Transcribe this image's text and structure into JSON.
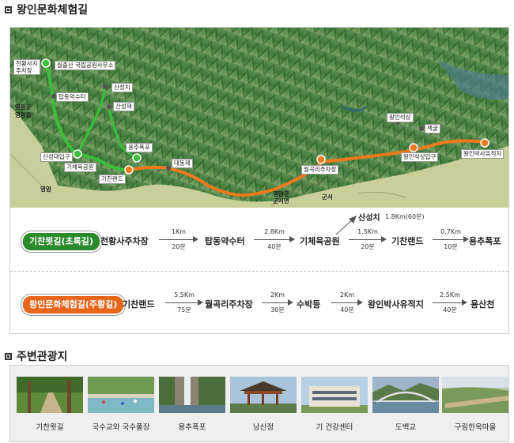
{
  "sections": {
    "main_title": "왕인문화체험길",
    "nearby_title": "주변관광지"
  },
  "map_labels": {
    "parking": "천황사지\n주차장",
    "park_office": "월출산 국립공원사무소",
    "tapdong": "탑동약수터",
    "sanseongchi": "산성치",
    "sanseongjae": "산성재",
    "sanseong_gate": "산성대입구",
    "gym_park": "기체육공원",
    "yongchu": "용추폭포",
    "gichan": "기찬랜드",
    "daedong": "대동제",
    "wolgok": "월곡리주차장",
    "wangin_site": "왕인석상",
    "chaekgul": "책굴",
    "wangin_entrance": "왕인석상입구",
    "wangin_relic": "왕인박사유적지",
    "county_office": "영암군\n영암읍",
    "gun_office": "영암군\n군서면",
    "yeongam": "영암",
    "gunseo": "군서"
  },
  "route_green": {
    "name": "기찬묏길(초록길)",
    "stops": [
      "천황사주차장",
      "탑동약수터",
      "기체육공원",
      "기찬랜드",
      "용추폭포"
    ],
    "segments": [
      {
        "dist": "1Km",
        "time": "20분"
      },
      {
        "dist": "2.8Km",
        "time": "40분"
      },
      {
        "dist": "1.5Km",
        "time": "20분"
      },
      {
        "dist": "0.7Km",
        "time": "10분"
      }
    ],
    "branch": {
      "stop": "산성치",
      "dist": "1.8Km(60분)"
    }
  },
  "route_orange": {
    "name": "왕인문화체험길(주황길)",
    "stops": [
      "기찬랜드",
      "월곡리주차장",
      "수박등",
      "왕인박사유적지",
      "용산천"
    ],
    "segments": [
      {
        "dist": "5.5Km",
        "time": "75분"
      },
      {
        "dist": "2Km",
        "time": "30분"
      },
      {
        "dist": "2Km",
        "time": "40분"
      },
      {
        "dist": "2.5Km",
        "time": "40분"
      }
    ]
  },
  "gallery": [
    {
      "caption": "기찬묏길",
      "icon": "forest-path-photo"
    },
    {
      "caption": "국수교와 국수폴장",
      "icon": "river-pool-photo"
    },
    {
      "caption": "용추폭포",
      "icon": "waterfall-photo"
    },
    {
      "caption": "낭산정",
      "icon": "pavilion-photo"
    },
    {
      "caption": "기 건강센터",
      "icon": "building-photo"
    },
    {
      "caption": "도백교",
      "icon": "bridge-photo"
    },
    {
      "caption": "구림한옥마을",
      "icon": "village-photo"
    }
  ],
  "colors": {
    "green_route": "#2b8a2b",
    "orange_route": "#e8651a",
    "mountain": "#3f7a3a",
    "field": "#c9cf9a"
  }
}
